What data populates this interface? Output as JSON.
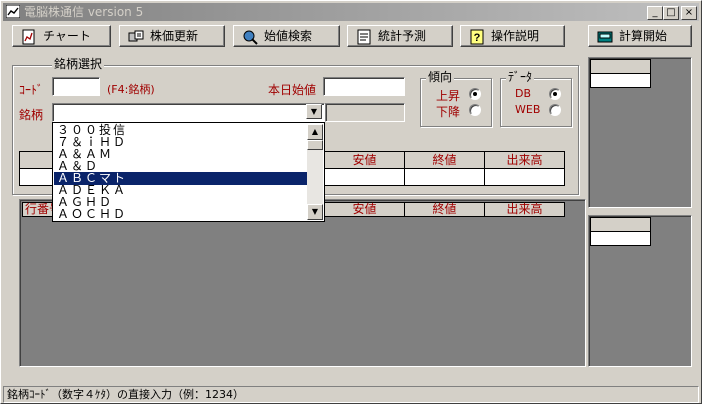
{
  "window": {
    "title": "電脳株通信 version 5",
    "controls": {
      "minimize": "_",
      "maximize": "□",
      "close": "×"
    }
  },
  "toolbar": {
    "buttons": [
      {
        "label": "チャート",
        "icon": "chart-icon"
      },
      {
        "label": "株価更新",
        "icon": "update-icon"
      },
      {
        "label": "始値検索",
        "icon": "search-icon"
      },
      {
        "label": "統計予測",
        "icon": "statistics-icon"
      },
      {
        "label": "操作説明",
        "icon": "help-icon"
      },
      {
        "label": "計算開始",
        "icon": "calculate-icon"
      }
    ]
  },
  "stock_select": {
    "group_label": "銘柄選択",
    "code_label": "ｺｰﾄﾞ",
    "code_value": "",
    "code_hint": "(F4:銘柄)",
    "open_price_label": "本日始値",
    "open_price_value": "",
    "name_label": "銘柄",
    "name_value": "",
    "dropdown_options": [
      "３００投信",
      "７＆ｉＨＤ",
      "Ａ＆ＡＭ",
      "Ａ＆Ｄ",
      "ＡＢＣマト",
      "ＡＤＥＫＡ",
      "ＡＧＨＤ",
      "ＡＯＣＨＤ"
    ],
    "selected_option": "ＡＢＣマト"
  },
  "trend": {
    "group_label": "傾向",
    "options": [
      {
        "label": "上昇",
        "selected": true
      },
      {
        "label": "下降",
        "selected": false
      }
    ]
  },
  "data_source": {
    "group_label": "ﾃﾞｰﾀ",
    "options": [
      {
        "label": "DB",
        "selected": true
      },
      {
        "label": "WEB",
        "selected": false
      }
    ]
  },
  "price_table": {
    "headers": [
      "安値",
      "終値",
      "出来高"
    ]
  },
  "results_table": {
    "headers": [
      "行番号",
      "安値",
      "終値",
      "出来高"
    ]
  },
  "status_bar": {
    "text": "銘柄ｺｰﾄﾞ（数字４ｹﾀ）の直接入力（例：1234）"
  },
  "colors": {
    "window_face": "#d4d0c8",
    "title_inactive": "#808080",
    "label_red": "#a00000",
    "selection": "#0a246a",
    "panel_gray": "#808080"
  }
}
